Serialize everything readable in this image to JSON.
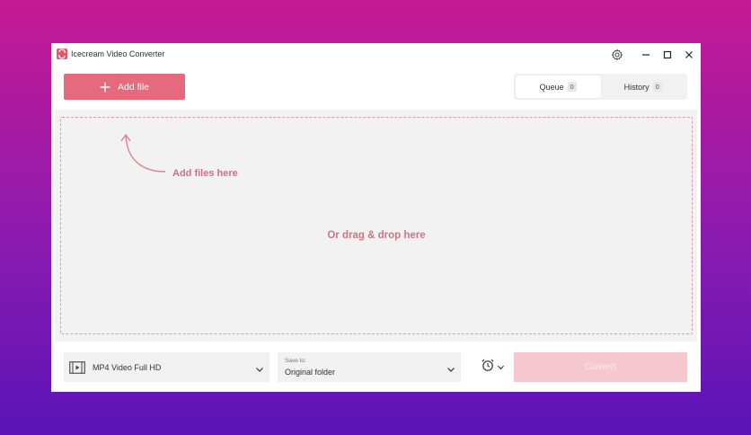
{
  "window": {
    "title": "Icecream Video Converter"
  },
  "toolbar": {
    "add_file_label": "Add file",
    "tabs": [
      {
        "label": "Queue",
        "count": "0"
      },
      {
        "label": "History",
        "count": "0"
      }
    ]
  },
  "dropzone": {
    "hint": "Add files here",
    "drop_text": "Or drag & drop here"
  },
  "bottom": {
    "format_value": "MP4 Video Full HD",
    "save_to_caption": "Save to:",
    "save_to_value": "Original folder",
    "convert_label": "Convert"
  },
  "icons": [
    "app-logo",
    "gear-icon",
    "minimize-icon",
    "maximize-icon",
    "close-icon",
    "plus-icon",
    "curved-arrow-icon",
    "film-icon",
    "chevron-down-icon",
    "alarm-clock-icon"
  ],
  "colors": {
    "accent": "#e46a7c",
    "accent_disabled": "#f5c8d0",
    "hint_text": "#d06e82",
    "dash_border": "#e39aa6"
  }
}
